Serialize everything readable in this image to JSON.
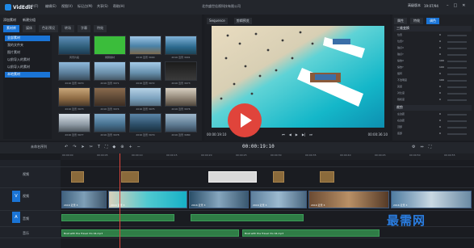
{
  "app": {
    "logo_text": "VidEdit",
    "doc_title": "北京盛世佳视科技有限公司"
  },
  "menu": [
    "文件(F)",
    "编辑(E)",
    "视图(V)",
    "标记点(M)",
    "共享(S)",
    "帮助(H)"
  ],
  "user": {
    "left": "高级版本",
    "right": "19:07/94"
  },
  "media": {
    "toolbar": [
      "添加素材",
      "新建分组"
    ],
    "tabs": [
      "素材库",
      "媒体",
      "色彩预设",
      "转场",
      "字幕",
      "特效"
    ],
    "tree": [
      "全部素材",
      "我的文件夹",
      "图片素材",
      "以前导入的素材",
      "以前导入的素材",
      "本地素材"
    ],
    "thumbs": [
      {
        "label": "风景片段"
      },
      {
        "label": "绿屏素材"
      },
      {
        "label": "2016 近景 3000"
      },
      {
        "label": "2016 近景 3001"
      },
      {
        "label": "2016 近景 3070"
      },
      {
        "label": "2016 近景 3071"
      },
      {
        "label": "2016 近景 3072"
      },
      {
        "label": "2016 近景 3073"
      },
      {
        "label": "2016 近景 3073"
      },
      {
        "label": "2016 近景 3074"
      },
      {
        "label": "2016 近景 3075"
      },
      {
        "label": "2016 近景 3076"
      },
      {
        "label": "2016 近景 3077"
      },
      {
        "label": "2016 近景 3078"
      },
      {
        "label": "2016 近景 3079"
      },
      {
        "label": "2016 近景 3080"
      }
    ]
  },
  "preview": {
    "tabs": [
      "Sequence",
      "剪辑预览"
    ],
    "time_left": "00:00:19:10",
    "time_right": "00:00:36:10"
  },
  "properties": {
    "tabs": [
      "属性",
      "特效",
      "调色"
    ],
    "section1": "三维变换",
    "rows1": [
      {
        "label": "位置",
        "value": "0"
      },
      {
        "label": "位置Y",
        "value": "0"
      },
      {
        "label": "锚点X",
        "value": "0"
      },
      {
        "label": "锚点Y",
        "value": "0"
      },
      {
        "label": "缩放X",
        "value": "100"
      },
      {
        "label": "缩放Y",
        "value": "100"
      },
      {
        "label": "旋转",
        "value": "0"
      },
      {
        "label": "不透明度",
        "value": "100"
      },
      {
        "label": "亮度",
        "value": "0"
      },
      {
        "label": "对比度",
        "value": "0"
      },
      {
        "label": "饱和度",
        "value": "0"
      }
    ],
    "section2": "裁剪",
    "rows2": [
      {
        "label": "左边距",
        "value": "0"
      },
      {
        "label": "右边距",
        "value": "0"
      },
      {
        "label": "顶部",
        "value": "0"
      },
      {
        "label": "底部",
        "value": "0"
      },
      {
        "label": "羽化",
        "value": "0"
      }
    ]
  },
  "timeline": {
    "label": "未命名序列",
    "timecode": "00:00:19:10",
    "ruler": [
      "00:00:00",
      "00:00:05",
      "00:00:10",
      "00:00:15",
      "00:00:20",
      "00:00:25",
      "00:00:30",
      "00:00:35",
      "00:00:40",
      "00:00:45",
      "00:00:50",
      "00:00:55"
    ],
    "tracks": [
      "视频",
      "视频",
      "V",
      "音频",
      "A",
      "音乐"
    ],
    "clip_label": "2016 近景 3",
    "audio_label": "Boat with the Travel Vlo 04.mp3"
  },
  "watermark": "最需网"
}
